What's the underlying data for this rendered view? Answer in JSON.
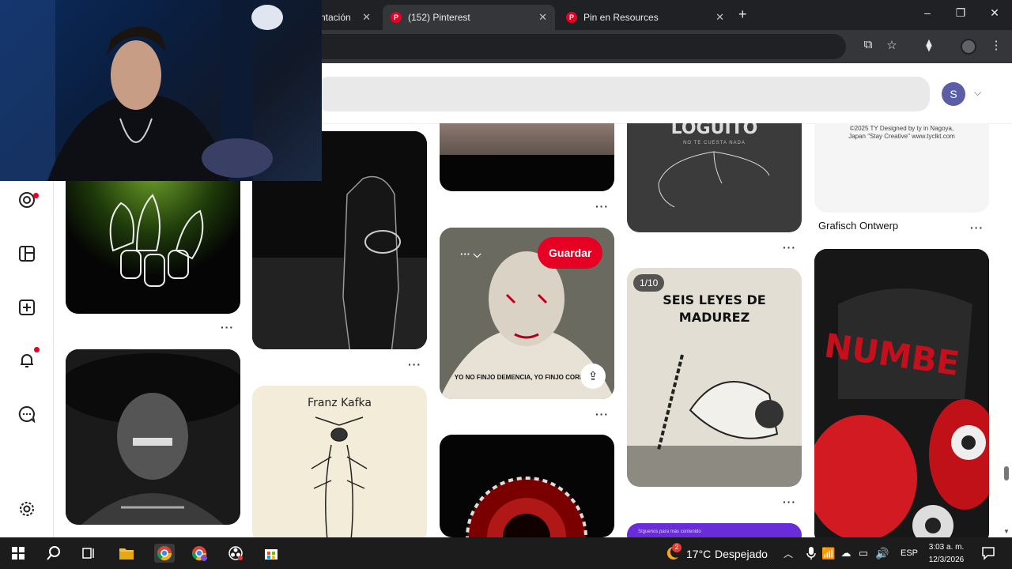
{
  "browser": {
    "tabs": [
      {
        "title": "ntación"
      },
      {
        "title": "(152) Pinterest",
        "active": true
      },
      {
        "title": "Pin en Resources"
      }
    ],
    "window_controls": {
      "minimize": "–",
      "maximize": "❐",
      "close": "✕"
    },
    "new_tab": "+"
  },
  "pinterest": {
    "avatar_initial": "S",
    "sidebar_icons": [
      "explore-icon",
      "boards-icon",
      "create-icon",
      "notifications-icon",
      "messages-icon",
      "settings-icon"
    ],
    "pins": {
      "kafka_title": "Franz Kafka",
      "seis_title": "SEIS LEYES DE MADUREZ",
      "seis_counter": "1/10",
      "clown_caption": "YO NO FINJO DEMENCIA, YO FINJO CORDURA.",
      "save_label": "Guardar",
      "loguito_title": "LOGUITO",
      "loguito_subtitle": "NO TE CUESTA NADA",
      "ty_text": "©2025 TY Designed by ty in Nagoya, Japan \"Stay Creative\" www.tyclkt.com",
      "grafisch_caption": "Grafisch Ontwerp",
      "promo_text": "Síguenos para más contenido",
      "more_dots": "···"
    }
  },
  "taskbar": {
    "weather_temp": "17°C",
    "weather_desc": "Despejado",
    "weather_badge": "2",
    "language": "ESP",
    "time": "3:03 a. m.",
    "date": "12/3/2026"
  },
  "colors": {
    "pinterest_red": "#e60023",
    "chrome_dark": "#202124",
    "chrome_tab": "#35363a",
    "avatar": "#5b5ea6",
    "taskbar": "#1c1c1c"
  }
}
